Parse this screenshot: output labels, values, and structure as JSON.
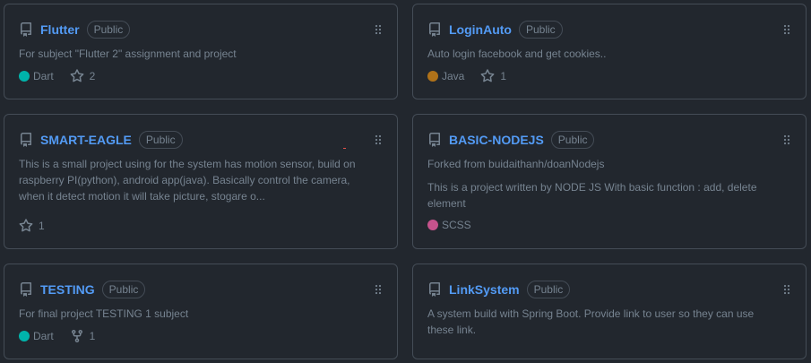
{
  "badge_label": "Public",
  "colors": {
    "link": "#539bf5",
    "dart": "#00b4ab",
    "java": "#b07219",
    "scss": "#c6538c"
  },
  "icons": {
    "repo": "repo-icon",
    "star": "star-icon",
    "fork": "fork-icon",
    "drag": "grabber-icon"
  },
  "repos": [
    {
      "name": "Flutter",
      "description": "For subject \"Flutter 2\" assignment and project",
      "language": "Dart",
      "stars": "2"
    },
    {
      "name": "LoginAuto",
      "description": "Auto login facebook and get cookies..",
      "language": "Java",
      "stars": "1"
    },
    {
      "name": "SMART-EAGLE",
      "description": "This is a small project using for the system has motion sensor, build on raspberry PI(python), android app(java). Basically control the camera, when it detect motion it will take picture, stogare o...",
      "stars": "1"
    },
    {
      "name": "BASIC-NODEJS",
      "forked_from": "Forked from buidaithanh/doanNodejs",
      "description": "This is a project written by NODE JS With basic function : add, delete element",
      "language": "SCSS"
    },
    {
      "name": "TESTING",
      "description": "For final project TESTING 1 subject",
      "language": "Dart",
      "forks": "1"
    },
    {
      "name": "LinkSystem",
      "description": "A system build with Spring Boot. Provide link to user so they can use these link."
    }
  ]
}
